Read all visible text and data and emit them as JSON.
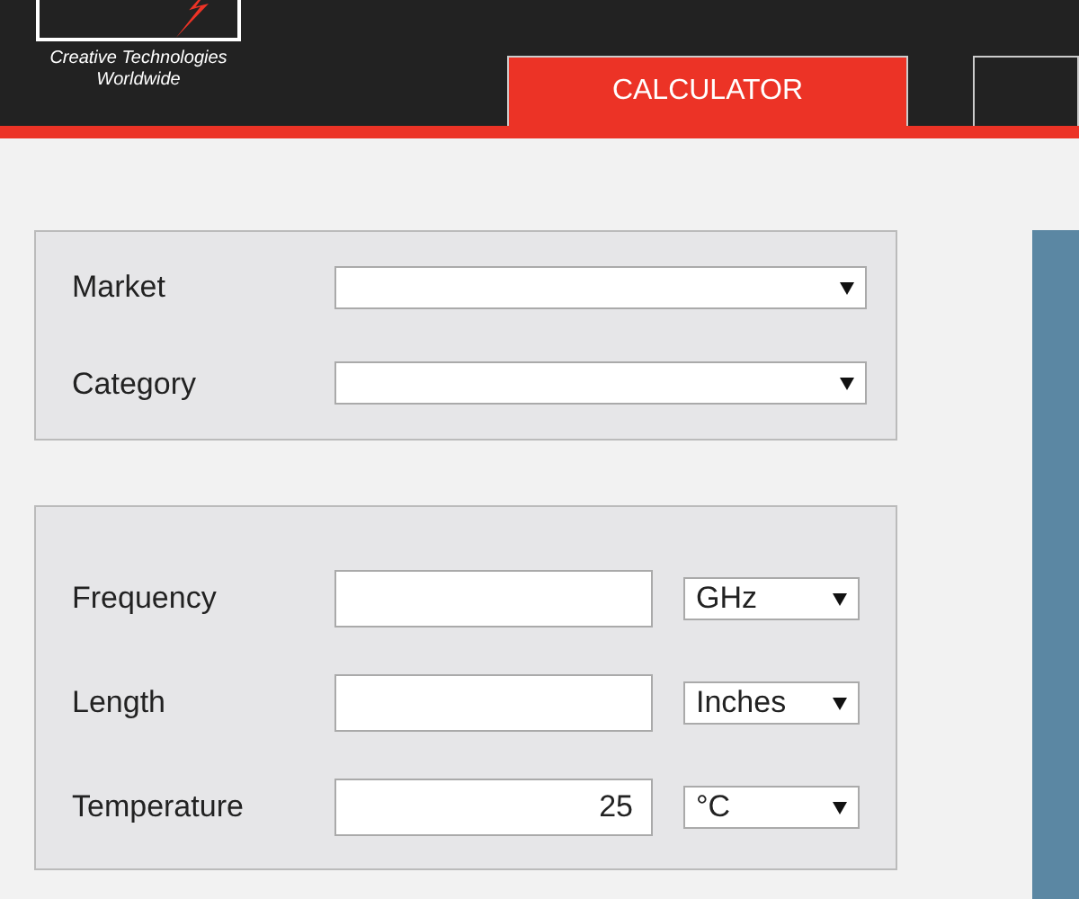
{
  "header": {
    "tagline": [
      "Creative Technologies",
      "Worldwide"
    ]
  },
  "tabs": [
    {
      "label": "CALCULATOR",
      "selected": true
    },
    {
      "selected": false
    }
  ],
  "panels": [
    {
      "fields": [
        {
          "kind": "select",
          "label": "Market"
        },
        {
          "kind": "select",
          "label": "Category"
        }
      ]
    },
    {
      "fields": [
        {
          "kind": "input_unit",
          "label": "Frequency",
          "unit": "GHz"
        },
        {
          "kind": "input_unit",
          "label": "Length",
          "unit": "Inches"
        },
        {
          "kind": "input_unit",
          "label": "Temperature",
          "value": "25",
          "unit": "°C"
        }
      ]
    }
  ]
}
